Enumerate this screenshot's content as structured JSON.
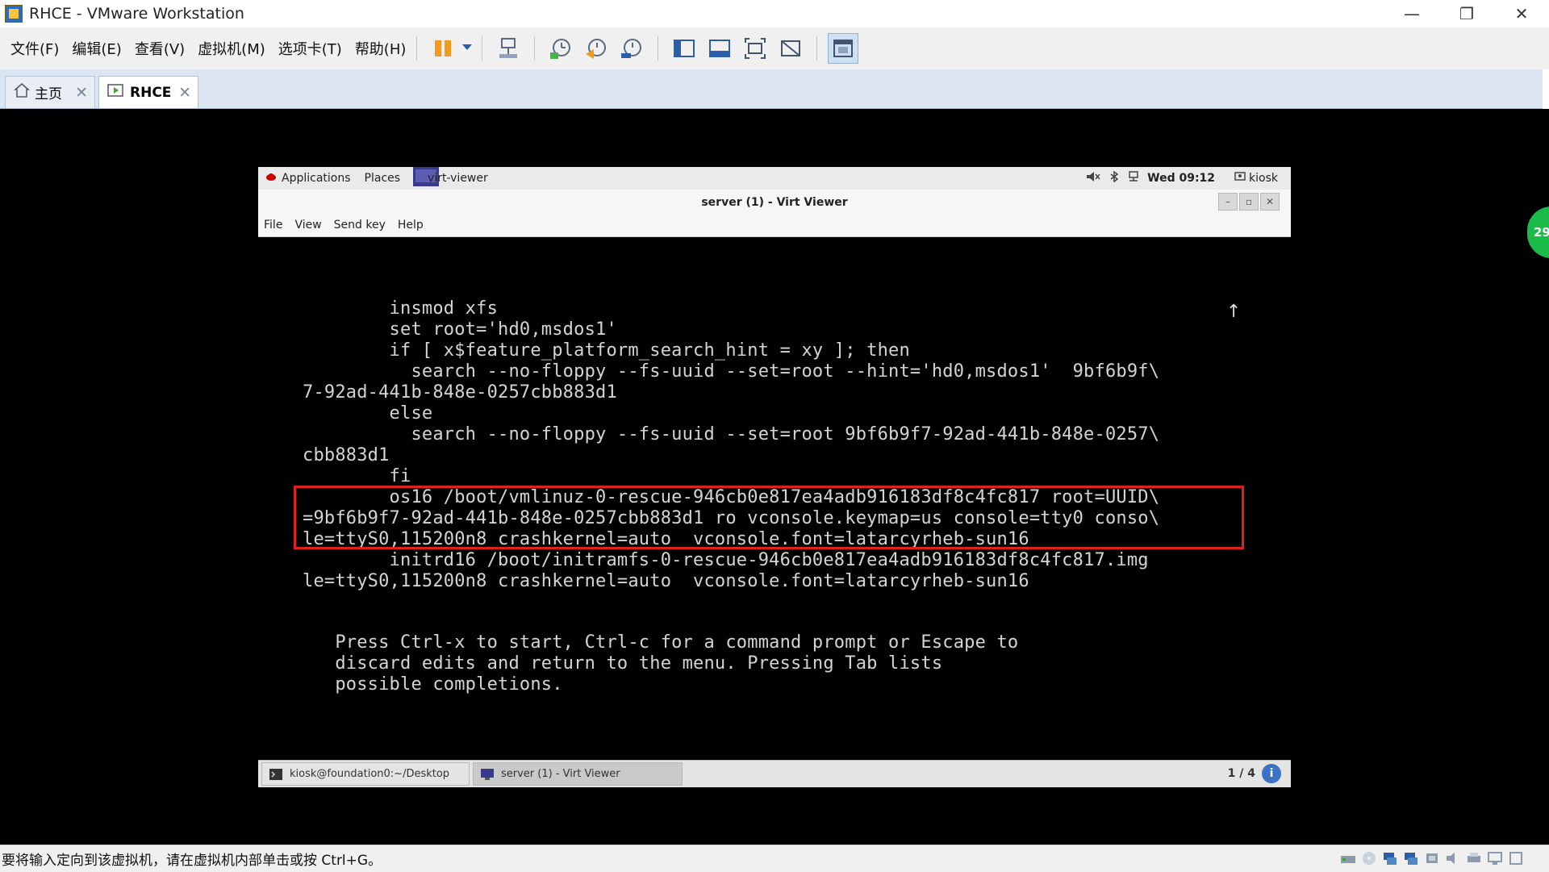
{
  "window": {
    "title": "RHCE - VMware Workstation",
    "controls": [
      "—",
      "❐",
      "✕"
    ]
  },
  "menubar": [
    "文件(F)",
    "编辑(E)",
    "查看(V)",
    "虚拟机(M)",
    "选项卡(T)",
    "帮助(H)"
  ],
  "tabs": [
    {
      "label": "主页"
    },
    {
      "label": "RHCE"
    }
  ],
  "badge": "29",
  "guest": {
    "topbar": {
      "applications": "Applications",
      "places": "Places",
      "window_name": "virt-viewer",
      "clock": "Wed 09:12",
      "user": "kiosk"
    },
    "viewer": {
      "title": "server (1) - Virt Viewer",
      "menu": [
        "File",
        "View",
        "Send key",
        "Help"
      ],
      "buttons": [
        "–",
        "▫",
        "✕"
      ]
    },
    "console": {
      "lines_before": [
        "        insmod xfs",
        "        set root='hd0,msdos1'",
        "        if [ x$feature_platform_search_hint = xy ]; then",
        "          search --no-floppy --fs-uuid --set=root --hint='hd0,msdos1'  9bf6b9f\\",
        "7-92ad-441b-848e-0257cbb883d1",
        "        else",
        "          search --no-floppy --fs-uuid --set=root 9bf6b9f7-92ad-441b-848e-0257\\",
        "cbb883d1",
        "        fi"
      ],
      "highlighted": [
        "        os16 /boot/vmlinuz-0-rescue-946cb0e817ea4adb916183df8c4fc817 root=UUID\\",
        "=9bf6b9f7-92ad-441b-848e-0257cbb883d1 ro vconsole.keymap=us console=tty0 conso\\",
        "le=ttyS0,115200n8 crashkernel=auto  vconsole.font=latarcyrheb-sun16"
      ],
      "lines_after": [
        "        initrd16 /boot/initramfs-0-rescue-946cb0e817ea4adb916183df8c4fc817.img",
        "le=ttyS0,115200n8 crashkernel=auto  vconsole.font=latarcyrheb-sun16"
      ],
      "help": [
        "   Press Ctrl-x to start, Ctrl-c for a command prompt or Escape to",
        "   discard edits and return to the menu. Pressing Tab lists",
        "   possible completions."
      ],
      "scroll_indicator": "↑"
    },
    "taskbar": {
      "tasks": [
        "kiosk@foundation0:~/Desktop",
        "server (1) - Virt Viewer"
      ],
      "pager": "1 / 4",
      "info": "i"
    }
  },
  "statusbar": {
    "message": "要将输入定向到该虚拟机，请在虚拟机内部单击或按 Ctrl+G。"
  },
  "colors": {
    "highlight_box": "#e02020",
    "console_bg": "#000000",
    "console_text": "#d4d4d4",
    "badge": "#1bbb4a"
  }
}
